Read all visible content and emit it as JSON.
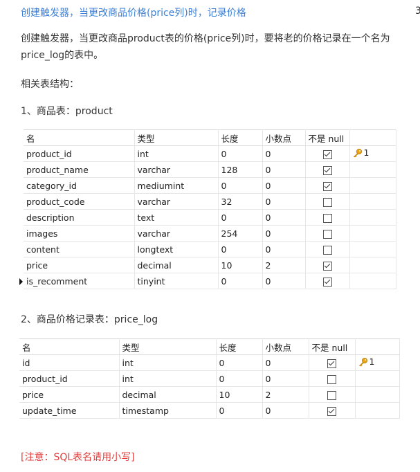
{
  "title": "创建触发器，当更改商品价格(price列)时，记录价格",
  "corner_number": "3",
  "intro": "创建触发器，当更改商品product表的价格(price列)时，要将老的价格记录在一个名为price_log的表中。",
  "related_label": "相关表结构：",
  "table1": {
    "heading": "1、商品表：product",
    "columns": [
      "名",
      "类型",
      "长度",
      "小数点",
      "不是 null",
      ""
    ],
    "rows": [
      {
        "name": "product_id",
        "type": "int",
        "length": "0",
        "decimals": "0",
        "not_null": true,
        "key": "1"
      },
      {
        "name": "product_name",
        "type": "varchar",
        "length": "128",
        "decimals": "0",
        "not_null": true,
        "key": ""
      },
      {
        "name": "category_id",
        "type": "mediumint",
        "length": "0",
        "decimals": "0",
        "not_null": true,
        "key": ""
      },
      {
        "name": "product_code",
        "type": "varchar",
        "length": "32",
        "decimals": "0",
        "not_null": false,
        "key": ""
      },
      {
        "name": "description",
        "type": "text",
        "length": "0",
        "decimals": "0",
        "not_null": false,
        "key": ""
      },
      {
        "name": "images",
        "type": "varchar",
        "length": "254",
        "decimals": "0",
        "not_null": false,
        "key": ""
      },
      {
        "name": "content",
        "type": "longtext",
        "length": "0",
        "decimals": "0",
        "not_null": false,
        "key": ""
      },
      {
        "name": "price",
        "type": "decimal",
        "length": "10",
        "decimals": "2",
        "not_null": true,
        "key": ""
      },
      {
        "name": "is_recomment",
        "type": "tinyint",
        "length": "0",
        "decimals": "0",
        "not_null": true,
        "key": "",
        "current": true
      }
    ]
  },
  "table2": {
    "heading": "2、商品价格记录表：price_log",
    "columns": [
      "名",
      "类型",
      "长度",
      "小数点",
      "不是 null",
      ""
    ],
    "rows": [
      {
        "name": "id",
        "type": "int",
        "length": "0",
        "decimals": "0",
        "not_null": true,
        "key": "1"
      },
      {
        "name": "product_id",
        "type": "int",
        "length": "0",
        "decimals": "0",
        "not_null": false,
        "key": ""
      },
      {
        "name": "price",
        "type": "decimal",
        "length": "10",
        "decimals": "2",
        "not_null": false,
        "key": ""
      },
      {
        "name": "update_time",
        "type": "timestamp",
        "length": "0",
        "decimals": "0",
        "not_null": true,
        "key": ""
      }
    ]
  },
  "note": "[注意：SQL表名请用小写]",
  "icons": {
    "primary_key": "key-icon",
    "current_row": "row-pointer-icon",
    "not_null": "checkbox-icon"
  },
  "colors": {
    "title": "#3b7fd6",
    "note": "#e03c3c",
    "key": "#e8a317"
  }
}
